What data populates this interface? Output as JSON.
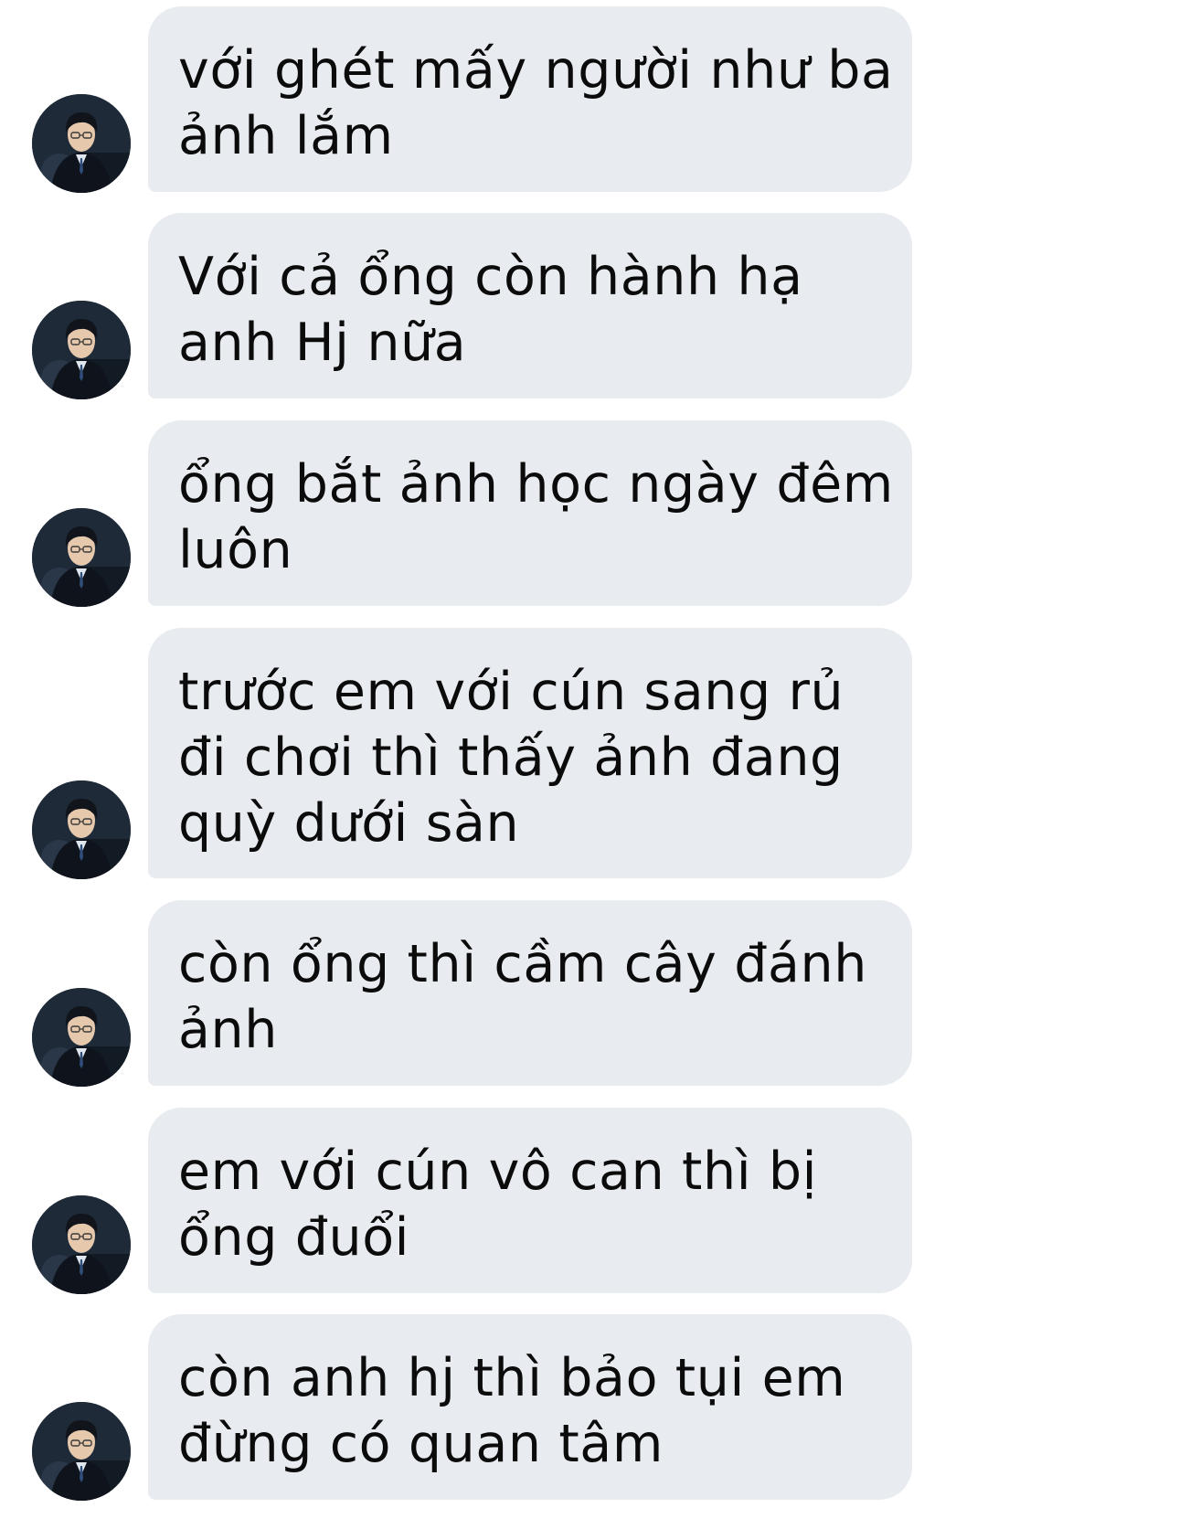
{
  "conversation": {
    "messages": [
      {
        "text": "với ghét mấy người như ba\nảnh lắm",
        "avatar_icon": "contact-avatar-icon"
      },
      {
        "text": "Với cả ổng còn hành hạ\nanh Hj nữa",
        "avatar_icon": "contact-avatar-icon"
      },
      {
        "text": "ổng bắt ảnh học ngày đêm\nluôn",
        "avatar_icon": "contact-avatar-icon"
      },
      {
        "text": "trước em với cún sang rủ\nđi chơi thì thấy ảnh đang\nquỳ dưới sàn",
        "avatar_icon": "contact-avatar-icon"
      },
      {
        "text": "còn ổng thì cầm cây đánh\nảnh",
        "avatar_icon": "contact-avatar-icon"
      },
      {
        "text": "em với cún vô can thì bị\nổng đuổi",
        "avatar_icon": "contact-avatar-icon"
      },
      {
        "text": "còn anh hj thì bảo tụi em\nđừng có quan tâm",
        "avatar_icon": "contact-avatar-icon"
      }
    ]
  },
  "colors": {
    "bubble_background": "#e8ebf0",
    "text": "#0b0b0b",
    "avatar_background": "#1f2a38"
  }
}
